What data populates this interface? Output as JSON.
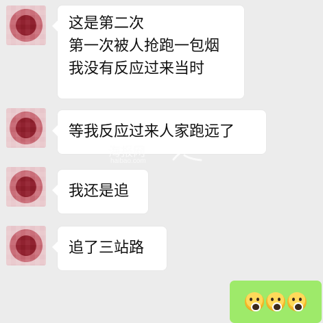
{
  "chat": {
    "messages": [
      {
        "side": "left",
        "lines": [
          "这是第二次",
          "第一次被人抢跑一包烟",
          "我没有反应过来当时"
        ]
      },
      {
        "side": "left",
        "lines": [
          "等我反应过来人家跑远了"
        ]
      },
      {
        "side": "left",
        "lines": [
          "我还是追"
        ]
      },
      {
        "side": "left",
        "lines": [
          "追了三站路"
        ]
      }
    ],
    "sent": {
      "emojis": [
        "face-screaming-in-fear",
        "face-screaming-in-fear",
        "face-screaming-in-fear"
      ]
    }
  },
  "watermark": {
    "text": "海报网",
    "subtext": "haibao.com"
  }
}
